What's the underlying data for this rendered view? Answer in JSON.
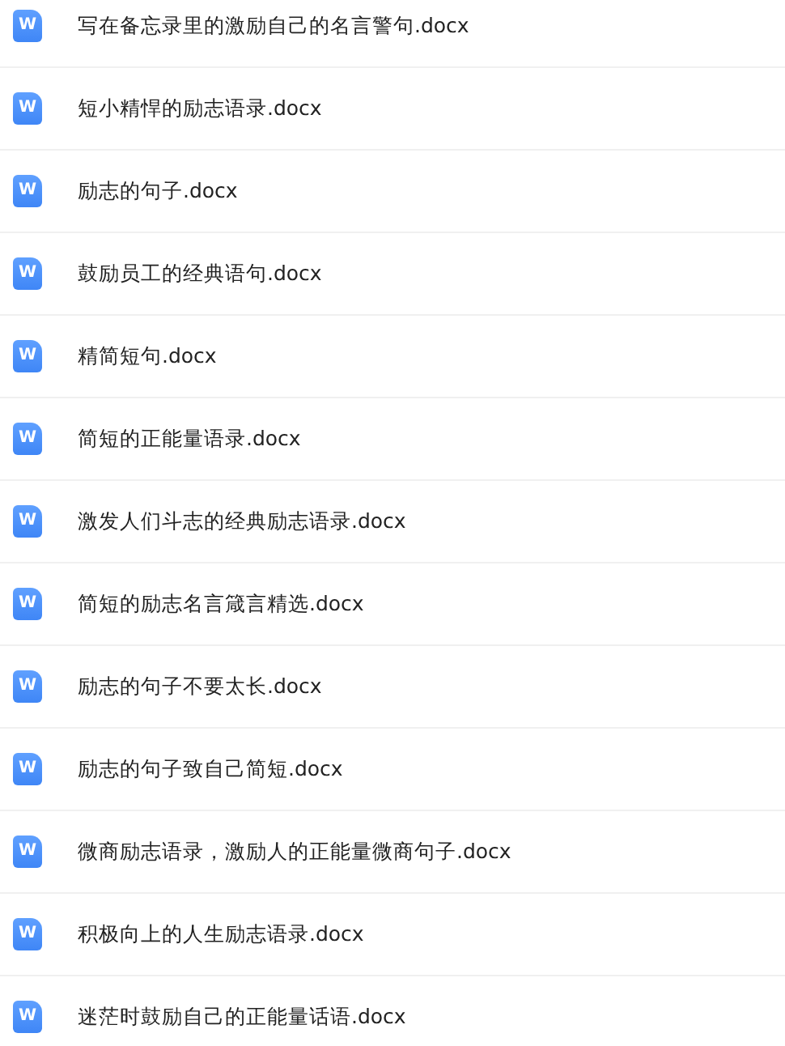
{
  "files": [
    {
      "icon_text": "W",
      "name": "写在备忘录里的激励自己的名言警句.docx"
    },
    {
      "icon_text": "W",
      "name": "短小精悍的励志语录.docx"
    },
    {
      "icon_text": "W",
      "name": "励志的句子.docx"
    },
    {
      "icon_text": "W",
      "name": "鼓励员工的经典语句.docx"
    },
    {
      "icon_text": "W",
      "name": "精简短句.docx"
    },
    {
      "icon_text": "W",
      "name": "简短的正能量语录.docx"
    },
    {
      "icon_text": "W",
      "name": "激发人们斗志的经典励志语录.docx"
    },
    {
      "icon_text": "W",
      "name": "简短的励志名言箴言精选.docx"
    },
    {
      "icon_text": "W",
      "name": "励志的句子不要太长.docx"
    },
    {
      "icon_text": "W",
      "name": "励志的句子致自己简短.docx"
    },
    {
      "icon_text": "W",
      "name": "微商励志语录，激励人的正能量微商句子.docx"
    },
    {
      "icon_text": "W",
      "name": "积极向上的人生励志语录.docx"
    },
    {
      "icon_text": "W",
      "name": "迷茫时鼓励自己的正能量话语.docx"
    }
  ]
}
